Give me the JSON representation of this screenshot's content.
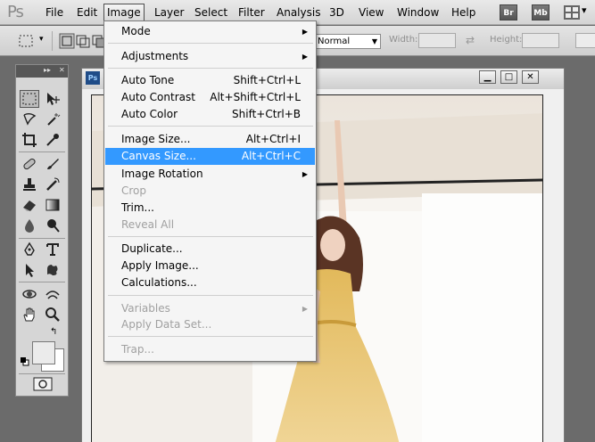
{
  "app": {
    "logo": "Ps"
  },
  "menubar": {
    "items": [
      "File",
      "Edit",
      "Image",
      "Layer",
      "Select",
      "Filter",
      "Analysis",
      "3D",
      "View",
      "Window",
      "Help"
    ],
    "bridge_label": "Br",
    "minibridge_label": "Mb"
  },
  "options": {
    "style_value": "Normal",
    "width_label": "Width:",
    "height_label": "Height:"
  },
  "doc": {
    "icon_label": "Ps"
  },
  "image_menu": {
    "mode": "Mode",
    "adjustments": "Adjustments",
    "auto_tone": "Auto Tone",
    "auto_tone_sc": "Shift+Ctrl+L",
    "auto_contrast": "Auto Contrast",
    "auto_contrast_sc": "Alt+Shift+Ctrl+L",
    "auto_color": "Auto Color",
    "auto_color_sc": "Shift+Ctrl+B",
    "image_size": "Image Size...",
    "image_size_sc": "Alt+Ctrl+I",
    "canvas_size": "Canvas Size...",
    "canvas_size_sc": "Alt+Ctrl+C",
    "image_rotation": "Image Rotation",
    "crop": "Crop",
    "trim": "Trim...",
    "reveal_all": "Reveal All",
    "duplicate": "Duplicate...",
    "apply_image": "Apply Image...",
    "calculations": "Calculations...",
    "variables": "Variables",
    "apply_data_set": "Apply Data Set...",
    "trap": "Trap..."
  },
  "colors": {
    "highlight": "#3399ff",
    "menu_bg": "#f5f5f5",
    "disabled_text": "#a0a0a0"
  }
}
